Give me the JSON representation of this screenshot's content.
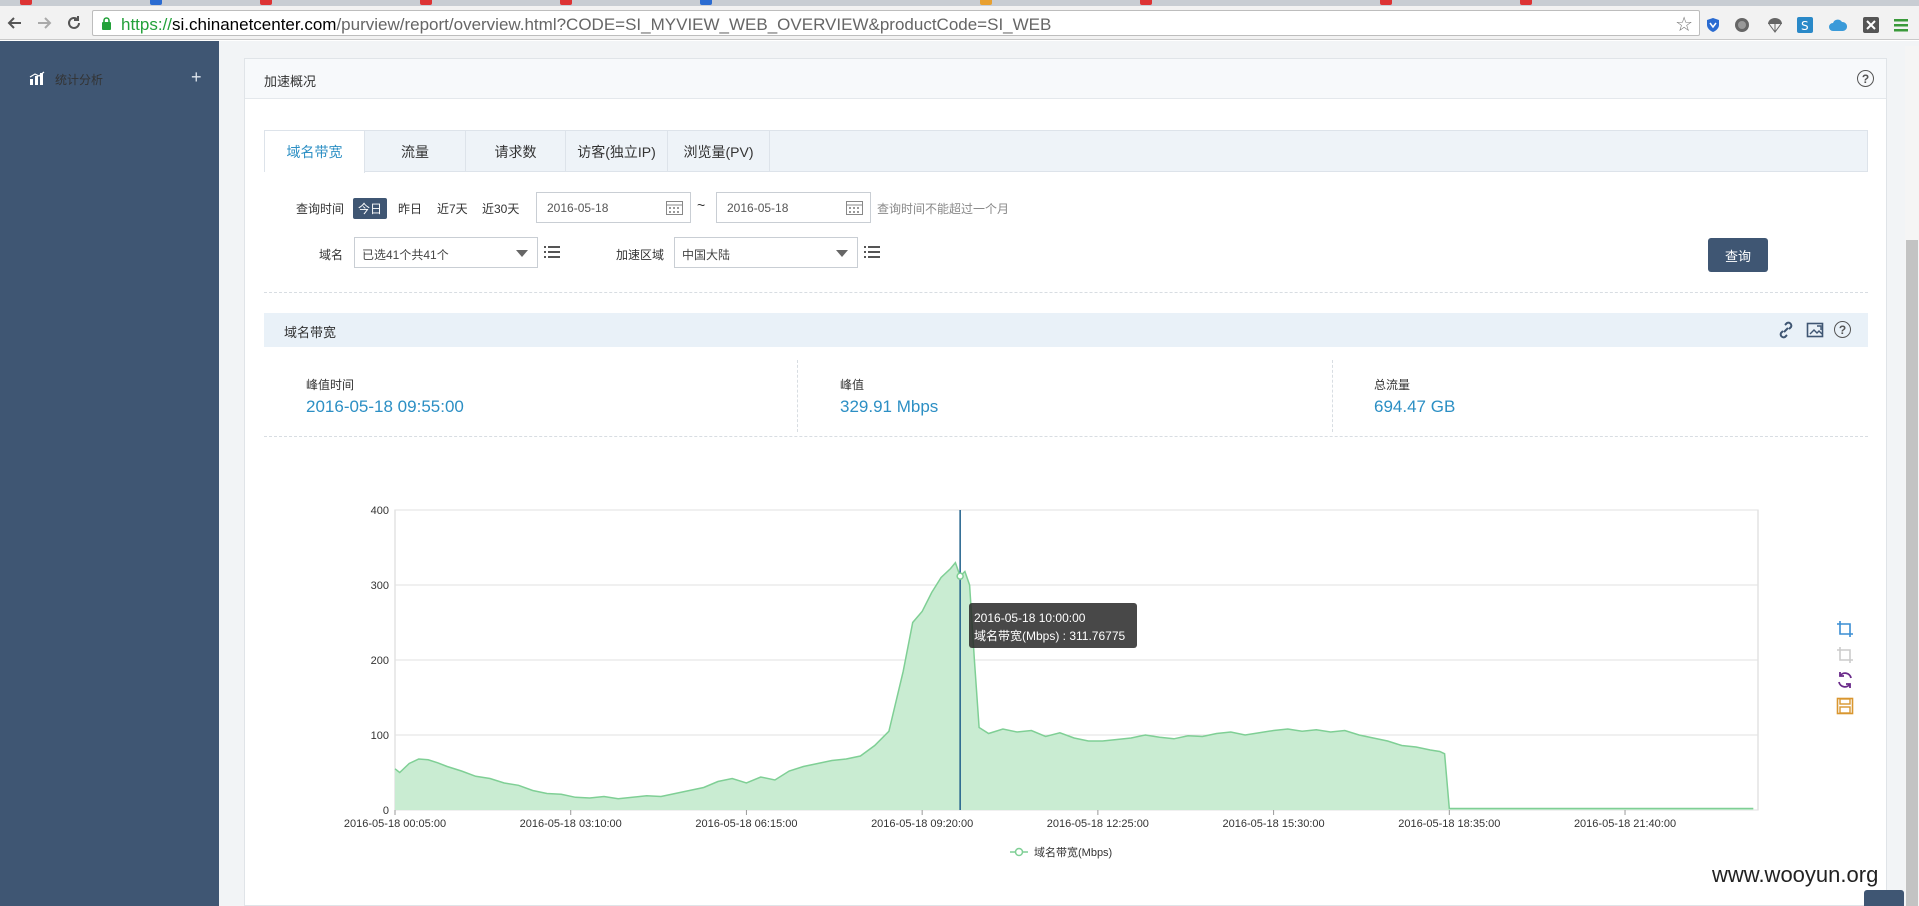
{
  "browser": {
    "url_scheme": "https://",
    "url_host": "si.chinanetcenter.com",
    "url_rest": "/purview/report/overview.html?CODE=SI_MYVIEW_WEB_OVERVIEW&productCode=SI_WEB",
    "extensions": [
      "shield-icon",
      "globe-icon",
      "parachute-icon",
      "s-icon",
      "cloud-icon",
      "x-icon",
      "menu-icon"
    ]
  },
  "sidebar": {
    "items": [
      {
        "label": "统计分析",
        "icon": "bar-chart-icon",
        "expander": "+"
      }
    ]
  },
  "panel": {
    "title": "加速概况"
  },
  "tabs": [
    {
      "label": "域名带宽",
      "active": true
    },
    {
      "label": "流量",
      "active": false
    },
    {
      "label": "请求数",
      "active": false
    },
    {
      "label": "访客(独立IP)",
      "active": false
    },
    {
      "label": "浏览量(PV)",
      "active": false
    }
  ],
  "filters": {
    "query_time_label": "查询时间",
    "quick": [
      "今日",
      "昨日",
      "近7天",
      "近30天"
    ],
    "start_date": "2016-05-18",
    "tilde": "~",
    "end_date": "2016-05-18",
    "hint": "查询时间不能超过一个月",
    "domain_label": "域名",
    "domain_value": "已选41个共41个",
    "region_label": "加速区域",
    "region_value": "中国大陆",
    "query_button": "查询"
  },
  "section": {
    "title": "域名带宽"
  },
  "stats": [
    {
      "label": "峰值时间",
      "value": "2016-05-18 09:55:00"
    },
    {
      "label": "峰值",
      "value": "329.91 Mbps"
    },
    {
      "label": "总流量",
      "value": "694.47 GB"
    }
  ],
  "tooltip": {
    "line1": "2016-05-18 10:00:00",
    "line2": "域名带宽(Mbps) : 311.76775"
  },
  "chart_data": {
    "type": "area",
    "x_tick_labels": [
      "2016-05-18 00:05:00",
      "2016-05-18 03:10:00",
      "2016-05-18 06:15:00",
      "2016-05-18 09:20:00",
      "2016-05-18 12:25:00",
      "2016-05-18 15:30:00",
      "2016-05-18 18:35:00",
      "2016-05-18 21:40:00"
    ],
    "y_ticks": [
      0,
      100,
      200,
      300,
      400
    ],
    "ylim": [
      0,
      400
    ],
    "xlim_minutes": [
      5,
      1440
    ],
    "legend": "域名带宽(Mbps)",
    "legend_position": "bottom",
    "grid": true,
    "series_color": "#7fcf95",
    "fill_color": "#c9ecd2",
    "crosshair_color": "#1f5f8b",
    "crosshair_time": "10:00",
    "series": [
      {
        "name": "域名带宽(Mbps)",
        "points": [
          [
            "00:05",
            55
          ],
          [
            "00:10",
            50
          ],
          [
            "00:20",
            62
          ],
          [
            "00:30",
            68
          ],
          [
            "00:40",
            67
          ],
          [
            "00:50",
            63
          ],
          [
            "01:00",
            58
          ],
          [
            "01:15",
            52
          ],
          [
            "01:30",
            45
          ],
          [
            "01:45",
            42
          ],
          [
            "02:00",
            36
          ],
          [
            "02:15",
            33
          ],
          [
            "02:30",
            26
          ],
          [
            "02:45",
            22
          ],
          [
            "03:00",
            21
          ],
          [
            "03:15",
            17
          ],
          [
            "03:30",
            16
          ],
          [
            "03:45",
            18
          ],
          [
            "04:00",
            15
          ],
          [
            "04:15",
            17
          ],
          [
            "04:30",
            19
          ],
          [
            "04:45",
            18
          ],
          [
            "05:00",
            22
          ],
          [
            "05:15",
            26
          ],
          [
            "05:30",
            30
          ],
          [
            "05:45",
            38
          ],
          [
            "06:00",
            42
          ],
          [
            "06:15",
            36
          ],
          [
            "06:30",
            44
          ],
          [
            "06:45",
            40
          ],
          [
            "07:00",
            52
          ],
          [
            "07:15",
            58
          ],
          [
            "07:30",
            62
          ],
          [
            "07:45",
            66
          ],
          [
            "08:00",
            68
          ],
          [
            "08:15",
            72
          ],
          [
            "08:30",
            86
          ],
          [
            "08:45",
            105
          ],
          [
            "09:00",
            185
          ],
          [
            "09:10",
            250
          ],
          [
            "09:20",
            265
          ],
          [
            "09:30",
            290
          ],
          [
            "09:40",
            310
          ],
          [
            "09:50",
            322
          ],
          [
            "09:55",
            329.91
          ],
          [
            "10:00",
            311.77
          ],
          [
            "10:05",
            318
          ],
          [
            "10:10",
            300
          ],
          [
            "10:15",
            200
          ],
          [
            "10:20",
            110
          ],
          [
            "10:30",
            102
          ],
          [
            "10:45",
            108
          ],
          [
            "11:00",
            104
          ],
          [
            "11:15",
            106
          ],
          [
            "11:30",
            98
          ],
          [
            "11:45",
            103
          ],
          [
            "12:00",
            96
          ],
          [
            "12:15",
            92
          ],
          [
            "12:30",
            92
          ],
          [
            "12:45",
            94
          ],
          [
            "13:00",
            96
          ],
          [
            "13:15",
            100
          ],
          [
            "13:30",
            97
          ],
          [
            "13:45",
            95
          ],
          [
            "14:00",
            99
          ],
          [
            "14:15",
            98
          ],
          [
            "14:30",
            102
          ],
          [
            "14:45",
            104
          ],
          [
            "15:00",
            100
          ],
          [
            "15:15",
            103
          ],
          [
            "15:30",
            106
          ],
          [
            "15:45",
            108
          ],
          [
            "16:00",
            105
          ],
          [
            "16:15",
            107
          ],
          [
            "16:30",
            104
          ],
          [
            "16:45",
            106
          ],
          [
            "17:00",
            100
          ],
          [
            "17:15",
            96
          ],
          [
            "17:30",
            92
          ],
          [
            "17:45",
            86
          ],
          [
            "18:00",
            84
          ],
          [
            "18:15",
            80
          ],
          [
            "18:25",
            78
          ],
          [
            "18:30",
            75
          ],
          [
            "18:35",
            2
          ],
          [
            "19:00",
            2
          ],
          [
            "20:00",
            2
          ],
          [
            "21:00",
            2
          ],
          [
            "21:40",
            2
          ],
          [
            "22:00",
            2
          ],
          [
            "23:00",
            2
          ],
          [
            "23:55",
            2
          ]
        ]
      }
    ]
  },
  "chart_tools": [
    "crop-icon",
    "crop-reset-icon",
    "refresh-icon",
    "save-icon"
  ],
  "section_tools": [
    "link-icon",
    "export-image-icon",
    "help-icon"
  ],
  "watermark": "www.wooyun.org"
}
